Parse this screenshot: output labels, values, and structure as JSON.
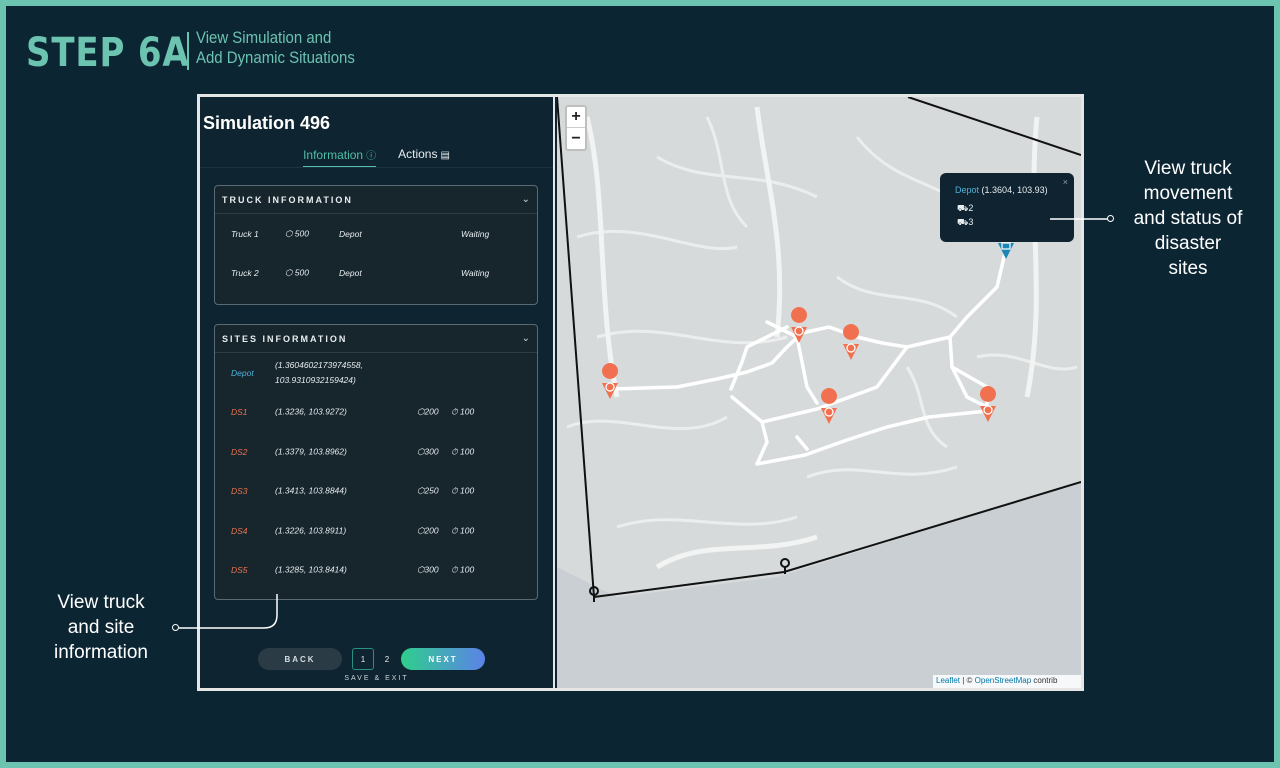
{
  "step": {
    "title": "STEP 6A",
    "subtitle_line1": "View Simulation and",
    "subtitle_line2": "Add Dynamic Situations"
  },
  "panel": {
    "title": "Simulation 496",
    "tabs": [
      {
        "label": "Information",
        "active": true,
        "icon": "info-icon"
      },
      {
        "label": "Actions",
        "active": false,
        "icon": "document-icon"
      }
    ],
    "truck_card": {
      "title": "TRUCK INFORMATION",
      "rows": [
        {
          "name": "Truck 1",
          "load_icon": "cube-icon",
          "load": "500",
          "location": "Depot",
          "status": "Waiting"
        },
        {
          "name": "Truck 2",
          "load_icon": "cube-icon",
          "load": "500",
          "location": "Depot",
          "status": "Waiting"
        }
      ]
    },
    "sites_card": {
      "title": "SITES INFORMATION",
      "depot": {
        "name": "Depot",
        "coord_line1": "(1.3604602173974558,",
        "coord_line2": "103.9310932159424)"
      },
      "rows": [
        {
          "name": "DS1",
          "coord": "(1.3236, 103.9272)",
          "supply": "200",
          "time": "100"
        },
        {
          "name": "DS2",
          "coord": "(1.3379, 103.8962)",
          "supply": "300",
          "time": "100"
        },
        {
          "name": "DS3",
          "coord": "(1.3413, 103.8844)",
          "supply": "250",
          "time": "100"
        },
        {
          "name": "DS4",
          "coord": "(1.3226, 103.8911)",
          "supply": "200",
          "time": "100"
        },
        {
          "name": "DS5",
          "coord": "(1.3285, 103.8414)",
          "supply": "300",
          "time": "100"
        }
      ]
    },
    "pager": {
      "back": "BACK",
      "page1": "1",
      "page2": "2",
      "next": "NEXT",
      "save_exit": "SAVE & EXIT"
    }
  },
  "map": {
    "zoom_in": "+",
    "zoom_out": "−",
    "popup": {
      "name": "Depot",
      "coords": "(1.3604, 103.93)",
      "trucks_a": "2",
      "trucks_b": "3",
      "close": "×"
    },
    "attribution": {
      "leaflet": "Leaflet",
      "separator": " | © ",
      "osm": "OpenStreetMap",
      "rest": " contrib"
    }
  },
  "callouts": {
    "right": [
      "View truck",
      "movement",
      "and status of",
      "disaster",
      "sites"
    ],
    "left": [
      "View truck",
      "and site",
      "information"
    ]
  },
  "colors": {
    "accent": "#6cc3b0",
    "background": "#0c2533",
    "site_marker": "#f0704f",
    "depot_marker": "#1d86b4",
    "route": "#ffffff"
  }
}
